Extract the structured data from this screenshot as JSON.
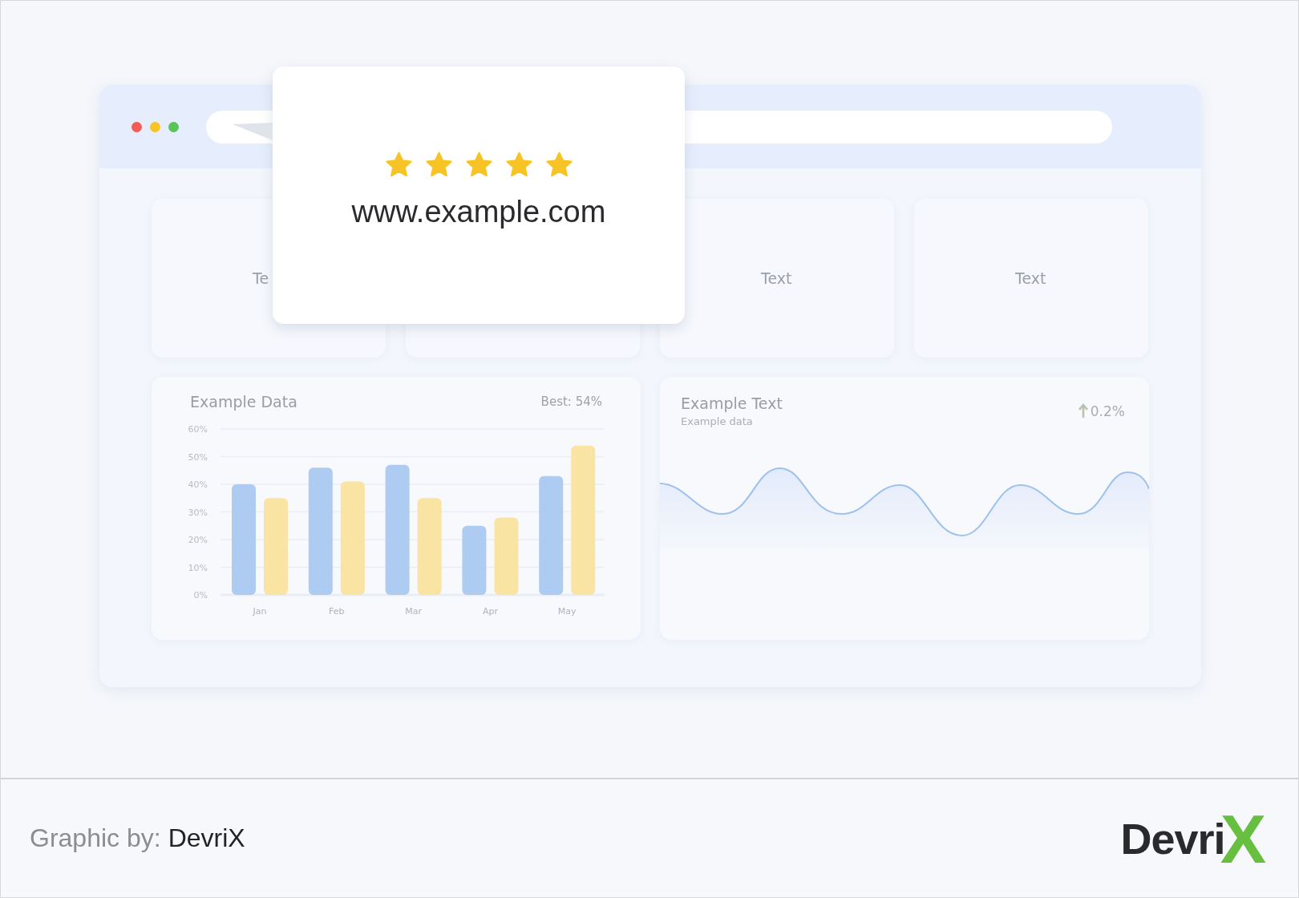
{
  "browser": {
    "window_controls": [
      {
        "color": "#f25c54"
      },
      {
        "color": "#f7c325"
      },
      {
        "color": "#5cc25a"
      }
    ]
  },
  "popup": {
    "stars": 5,
    "url": "www.example.com"
  },
  "cards": [
    {
      "kind": "text",
      "text": "Te"
    },
    {
      "kind": "blank"
    },
    {
      "kind": "text",
      "text": "Text"
    },
    {
      "kind": "text",
      "text": "Text"
    }
  ],
  "bar_card": {
    "title": "Example Data",
    "best": "Best: 54%",
    "chart_data": {
      "type": "bar",
      "categories": [
        "Jan",
        "Feb",
        "Mar",
        "Apr",
        "May"
      ],
      "series": [
        {
          "color": "#aecbf2",
          "values": [
            40,
            46,
            47,
            25,
            43
          ]
        },
        {
          "color": "#f9e4a3",
          "values": [
            35,
            41,
            35,
            28,
            54
          ]
        }
      ],
      "ylim": [
        0,
        60
      ],
      "grid": true,
      "yticks": [
        {
          "value": 0,
          "label": "0%"
        },
        {
          "value": 10,
          "label": "10%"
        },
        {
          "value": 20,
          "label": "20%"
        },
        {
          "value": 30,
          "label": "30%"
        },
        {
          "value": 40,
          "label": "40%"
        },
        {
          "value": 50,
          "label": "50%"
        },
        {
          "value": 60,
          "label": "60%"
        }
      ]
    }
  },
  "wave_card": {
    "title": "Example Text",
    "subtitle": "Example data",
    "change": "0.2%"
  },
  "footer": {
    "credit_label": "Graphic by:",
    "credit_name": "DevriX",
    "logo": {
      "text": "Devri",
      "mark": "X"
    }
  }
}
